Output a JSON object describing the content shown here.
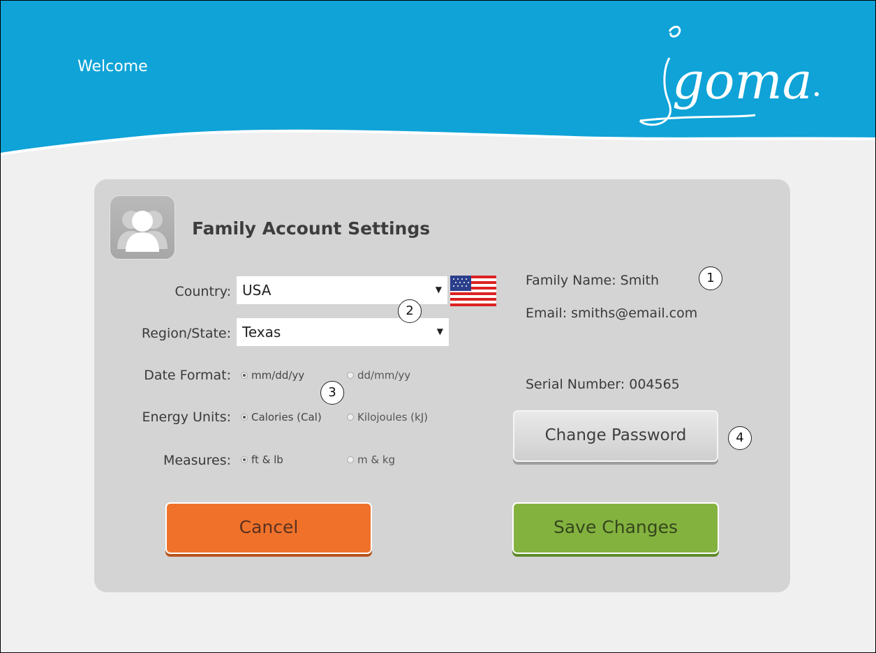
{
  "header": {
    "welcome": "Welcome",
    "brand": "igoma",
    "brand_mark": "®"
  },
  "panel": {
    "title": "Family Account Settings",
    "country": {
      "label": "Country:",
      "value": "USA"
    },
    "region": {
      "label": "Region/State:",
      "value": "Texas"
    },
    "date_format": {
      "label": "Date Format:",
      "options": [
        "mm/dd/yy",
        "dd/mm/yy"
      ],
      "selected": "mm/dd/yy"
    },
    "energy_units": {
      "label": "Energy Units:",
      "options": [
        "Calories (Cal)",
        "Kilojoules (kJ)"
      ],
      "selected": "Calories (Cal)"
    },
    "measures": {
      "label": "Measures:",
      "options": [
        "ft & lb",
        "m & kg"
      ],
      "selected": "ft & lb"
    },
    "family_name": "Family Name: Smith",
    "email": "Email: smiths@email.com",
    "serial": "Serial Number: 004565",
    "change_password": "Change Password",
    "cancel": "Cancel",
    "save": "Save Changes"
  },
  "callouts": [
    "1",
    "2",
    "3",
    "4"
  ],
  "colors": {
    "header_blue": "#0fa3d7",
    "cancel_orange": "#f0722a",
    "save_green": "#84b23f"
  },
  "icons": {
    "account": "family-account-icon",
    "flag": "usa-flag-icon",
    "dropdown": "dropdown-arrow-icon"
  }
}
